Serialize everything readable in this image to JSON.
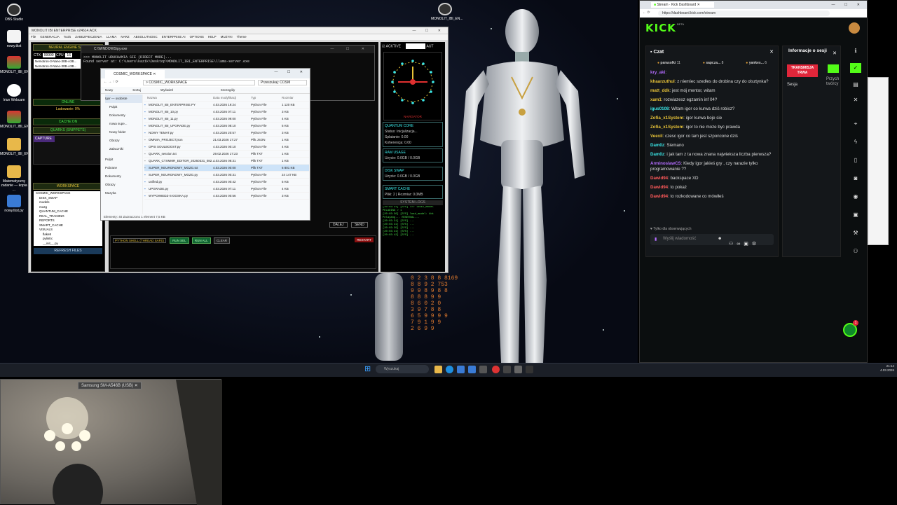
{
  "desktop": {
    "icons": [
      "OBS Studio",
      "nowy.tkst",
      "MONOLIT_IBI_EN...",
      "Iriun Webcam",
      "MONOLIT_IBI_EN...",
      "MONOLIT_IBI_EN...",
      "Matematyczny zadanie — kopia ...",
      "nowy.tkst.py"
    ],
    "top_icon": "MONOLIT_IBI_EN..."
  },
  "monolit_window": {
    "title": "MONOLIT IBI ENTERPRISE v24614.ACK",
    "menu": [
      "File",
      "GENERACJA",
      "Tools",
      "ZABEZPIECZENIA",
      "LLAMA",
      "NARZ",
      "ABSOLUTNOSC",
      "ENTERPRISE AI",
      "OPTIONS",
      "HELP",
      "MUZYKI",
      "Theme"
    ],
    "neural_engine": "NEURAL ENGINE STAR",
    "ctx_label": "CTX:",
    "ctx_value": "99999",
    "cpu_label": "CPU:",
    "cpu_value": "16",
    "models": [
      "Nemotron-3-Nano-30B-A3B...",
      "Nemotron-3-Nano-30B-A3B..."
    ],
    "online": "ONLINE",
    "loading": "Ladowanie: 0%",
    "cache_on": "CACHE:ON",
    "quarks": "QUARKS (SNIPPETS)",
    "capture": "CAPTURE",
    "workspace": "WORKSPACE",
    "tree": [
      "COSMIC_WORKSPACE",
      "DISK_SWAP",
      "models",
      "mozg",
      "QUANTUM_CACHE",
      "REAL_TRAINING",
      "REPORTS",
      "SMART_CACHE",
      "VISUALS",
      "flake8",
      "pylintrc",
      "__init__.py"
    ],
    "refresh": "REFRESH FILES"
  },
  "cmd_window": {
    "title": "C:\\WINDOWS\\py.exe",
    "lines": [
      ">>> MONOLIT URUCHAMIA SIE (DIRECT MODE)...",
      "Found server at: C:\\Users\\kazik\\Desktop\\MONOLIT_IBI_ENTERPRISE\\llama-server.exe"
    ]
  },
  "explorer": {
    "tab": "COSMIC_WORKSPACE",
    "path": "COSMIC_WORKSPACE",
    "search": "Przeszukaj: COSM",
    "toolbar": [
      "Nowy",
      "Sortuj",
      "Wyświetl",
      "Szczegóły"
    ],
    "cols": [
      "Nazwa",
      "Data modyfikacji",
      "Typ",
      "Rozmiar"
    ],
    "sidebar": [
      "Igor — osobiste",
      "Pulpit",
      "Dokumenty",
      "nowa supe...",
      "Nowy folder",
      "Obrazy",
      "Zalaczniki",
      "Pulpit",
      "Pobrane",
      "Dokumenty",
      "Obrazy",
      "Muzyka"
    ],
    "files": [
      [
        "MONOLIT_IBI_ENTERPRISE.PY",
        "4.03.2026 19:24",
        "Python File",
        "1 120 KB"
      ],
      [
        "MONOLIT_IBI_10.py",
        "4.03.2026 07:11",
        "Python File",
        "3 KB"
      ],
      [
        "MONOLIT_IBI_11.py",
        "4.03.2026 09:00",
        "Python File",
        "4 KB"
      ],
      [
        "MONOLIT_IBI_UPGRADE.py",
        "4.03.2026 08:10",
        "Python File",
        "5 KB"
      ],
      [
        "NOWY TEMAT.py",
        "4.03.2026 20:57",
        "Python File",
        "3 KB"
      ],
      [
        "OMNIIA_PROJECT.json",
        "21.03.2026 17:27",
        "Plik JSON",
        "1 KB"
      ],
      [
        "OPIS SOULBOOST.py",
        "4.03.2026 00:10",
        "Python File",
        "4 KB"
      ],
      [
        "QUARK_session.txt",
        "29.02.2026 17:23",
        "Plik TXT",
        "1 KB"
      ],
      [
        "QUARK_CTXMMR_EDITOR_20260331_082...",
        "4.03.2026 08:31",
        "Plik TXT",
        "1 KB"
      ],
      [
        "SUPER_NEURONOWY_MOZG.txt",
        "4.03.2026 00:00",
        "Plik TXT",
        "6 801 KB"
      ],
      [
        "SUPER_NEURONOWY_MOZG.py",
        "4.03.2026 00:31",
        "Python File",
        "24 147 KB"
      ],
      [
        "unified.py",
        "4.03.2026 00:42",
        "Python File",
        "5 KB"
      ],
      [
        "UPGRADE.py",
        "4.03.2026 07:11",
        "Python File",
        "4 KB"
      ],
      [
        "WYPOWIEDZ-S-DOSKA.py",
        "4.03.2026 00:56",
        "Python File",
        "3 KB"
      ]
    ],
    "status": "Elementy: 40    Zaznaczono 1 element 7,5 KB"
  },
  "shell": {
    "label": "PYTHON SHELL (THREAD SAFE)",
    "btns": [
      "RUN SEL",
      "RUN ALL",
      "CLEAR"
    ],
    "restart": "RESTART",
    "dalej": "DALEJ",
    "send": "SEND"
  },
  "right_panel": {
    "active": "ACKTIVE",
    "aut": "AUT",
    "navigator": "NAVIGATOR",
    "quantum_core": "QUANTUM CORE",
    "status_init": "Status: Inicjalizacja...",
    "splatanie": "Splatanie: 0.00",
    "koherencja": "Koherencja: 0.00",
    "ram_usage": "RAM USAGE",
    "ram_val": "Uzycie: 0.0GB / 0.0GB",
    "disk_swap": "DISK SWAP",
    "disk_val": "Uzycie: 0.0GB / 0.0GB",
    "smart_cache": "SMART CACHE",
    "cache_val": "Pliki: 2 | Rozmiar: 0.0MB",
    "system_logs": "SYSTEM LOGS",
    "logs": [
      "[20:03:31] [SYS] >>> lokal_model",
      "PELADING > 1",
      "[20:03:36] [SYS] load_model: kbt",
      "Pelayang... RESERVAL...",
      "[20:03:31] [SYS] ...",
      "[20:03:41] [SYS] ...",
      "[20:03:39] [SYS] ...",
      "[20:03:41] [SYS] ...",
      "[20:03:42] [SYS] ..."
    ]
  },
  "browser": {
    "tab": "Stream · Kick Dashboard",
    "url": "https://dashboard.kick.com/stream",
    "logo": "KICK",
    "beta": "BETA",
    "chat_title": "Czat",
    "top_users": [
      [
        "parasolki",
        "11"
      ],
      [
        "sapcza...",
        "8"
      ],
      [
        "yankes...",
        "6"
      ]
    ],
    "messages": [
      {
        "user": "kry_aki",
        "text": "",
        "color": "#b46cff"
      },
      {
        "user": "khaarzuthul",
        "text": "z niemiec szedłes do drobina czy do olsztynka?",
        "color": "#e6c238"
      },
      {
        "user": "matt_ddk",
        "text": "jest mój mentor, witam",
        "color": "#e6c238"
      },
      {
        "user": "xam1",
        "text": "rozwiazesz egzamin inf 04?",
        "color": "#e6c238"
      },
      {
        "user": "igus0108",
        "text": "Witam igor co kurwa dziś robisz?",
        "color": "#3ae6e6"
      },
      {
        "user": "Zofia_x1System",
        "text": "igor kurwa boje sie",
        "color": "#e6c238"
      },
      {
        "user": "Zofia_x1System",
        "text": "igor to nie moze byc prawda",
        "color": "#e6c238"
      },
      {
        "user": "Veexil",
        "text": "czesc igor co tam jest szponcone dziś",
        "color": "#e6c238"
      },
      {
        "user": "Dam0z",
        "text": "Siemano",
        "color": "#3ae6e6"
      },
      {
        "user": "Dam0z",
        "text": "i jak tam z ta nowa znana najwieksza liczba pierwsza?",
        "color": "#3ae6e6"
      },
      {
        "user": "ArminoslawCS",
        "text": "Kiedy igor jakieś gry , czy narazie tylko programowanie ??",
        "color": "#b46cff"
      },
      {
        "user": "Dawid94",
        "text": "backspace XD",
        "color": "#ff5a5a"
      },
      {
        "user": "Dawid94",
        "text": "to pokaż",
        "color": "#ff5a5a"
      },
      {
        "user": "Dawid94",
        "text": "to rozkodowane co mówiłeś",
        "color": "#ff5a5a"
      }
    ],
    "followers_only": "Tylko dla obserwujących",
    "input_placeholder": "Wyślij wiadomość",
    "info_title": "Informacje o sesji",
    "live_badge": "TRANSMISJA TRWA",
    "session": "Sesja",
    "przych": "Przych",
    "tworcy": "twórcy",
    "notif": "1"
  },
  "taskbar": {
    "search": "Wyszukaj",
    "time": "21:14",
    "date": "4.03.2026"
  },
  "webcam": {
    "label": "Samsung SM-A546B (USB)"
  },
  "colors": {
    "kick_green": "#53fc18",
    "panel_bg": "#000",
    "accent_gold": "#e6c238"
  }
}
